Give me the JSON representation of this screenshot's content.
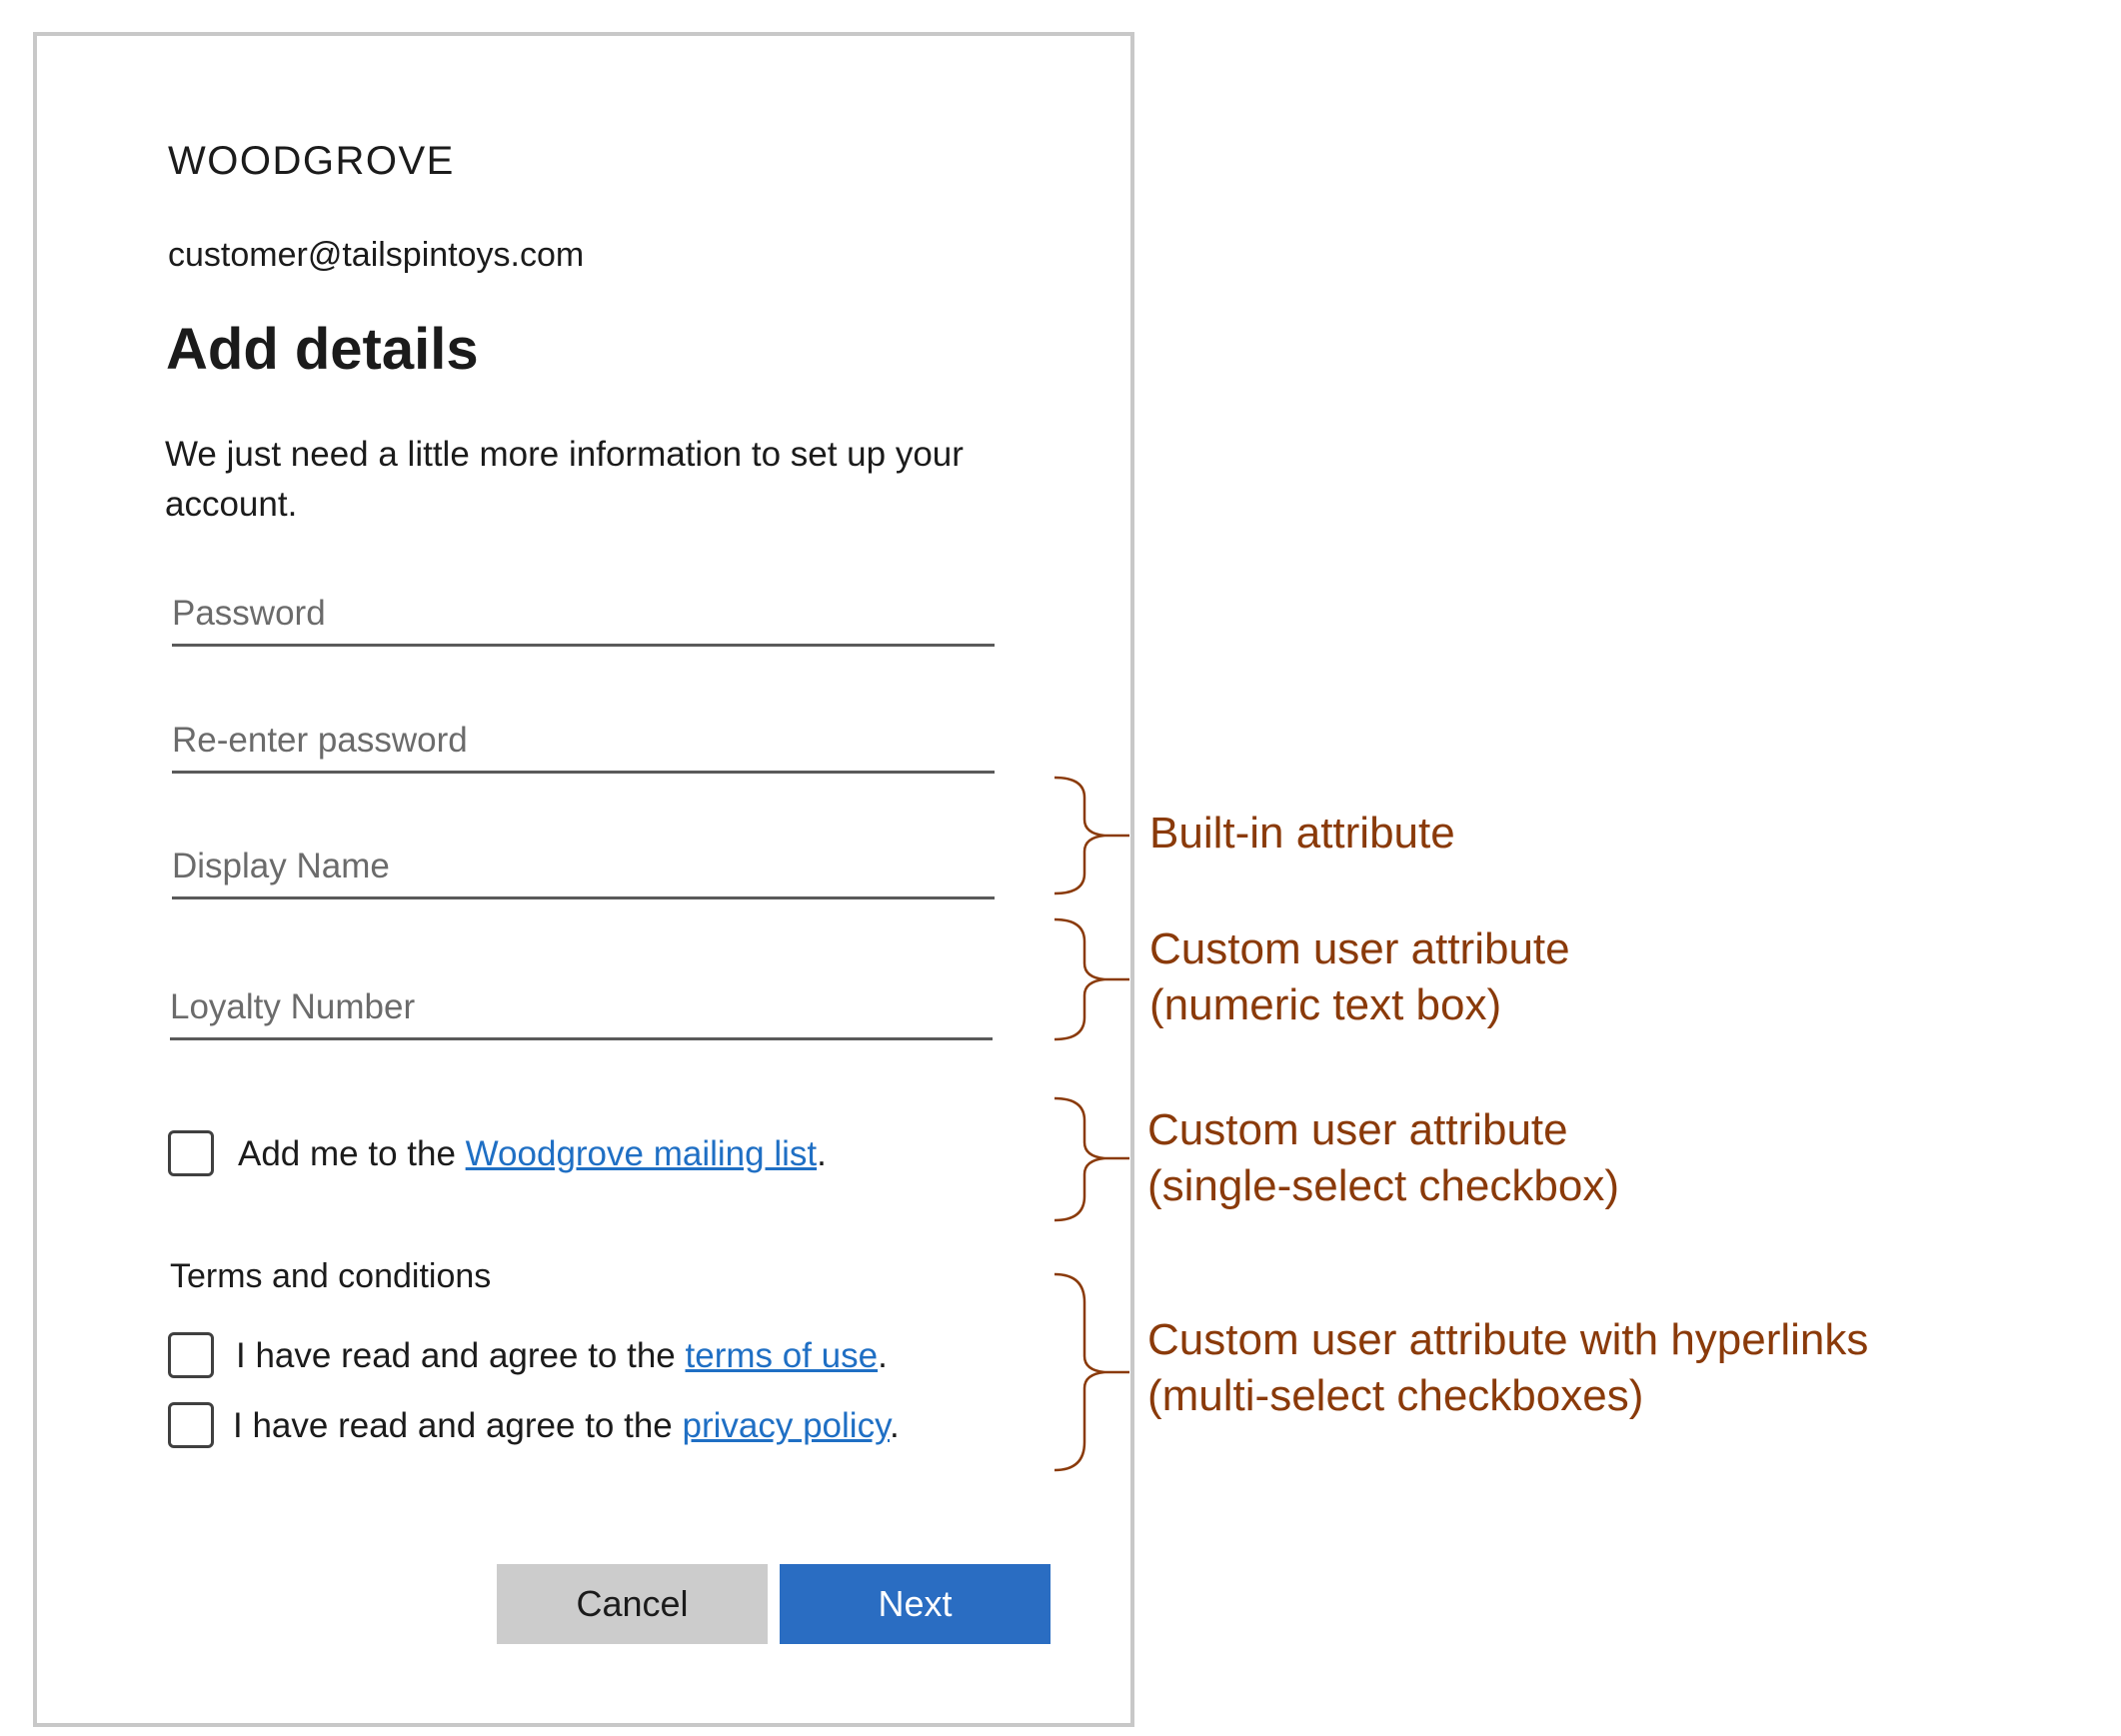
{
  "form": {
    "brand": "WOODGROVE",
    "email": "customer@tailspintoys.com",
    "title": "Add details",
    "description": "We just need a little more information to set up your account.",
    "fields": {
      "password": {
        "placeholder": "Password"
      },
      "reenter_password": {
        "placeholder": "Re-enter password"
      },
      "display_name": {
        "placeholder": "Display Name"
      },
      "loyalty_number": {
        "placeholder": "Loyalty Number"
      }
    },
    "mailing_list": {
      "prefix": "Add me to the ",
      "link": "Woodgrove mailing list",
      "suffix": "."
    },
    "terms": {
      "label": "Terms and conditions",
      "terms_of_use": {
        "prefix": "I have read and agree to the ",
        "link": "terms of use",
        "suffix": "."
      },
      "privacy_policy": {
        "prefix": "I have read and agree to the ",
        "link": "privacy policy",
        "suffix": "."
      }
    },
    "buttons": {
      "cancel": "Cancel",
      "next": "Next"
    }
  },
  "annotations": {
    "built_in": {
      "line1": "Built-in attribute"
    },
    "numeric": {
      "line1": "Custom user attribute",
      "line2": "(numeric text box)"
    },
    "single_select": {
      "line1": "Custom user attribute",
      "line2": "(single-select checkbox)"
    },
    "multi_select": {
      "line1": "Custom user attribute with hyperlinks",
      "line2": "(multi-select checkboxes)"
    }
  },
  "colors": {
    "annotation": "#8a3a0a",
    "link": "#1f6fc4",
    "primary_button": "#2a6dc2",
    "secondary_button": "#cccccc"
  }
}
